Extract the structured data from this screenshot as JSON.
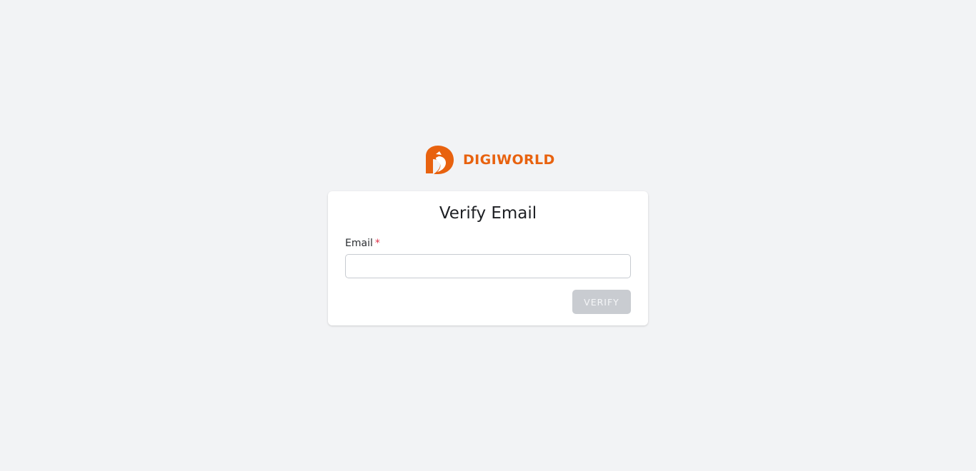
{
  "brand": {
    "name": "DIGIWORLD",
    "color": "#e8620f",
    "logo_icon": "digiworld-logo-icon"
  },
  "form": {
    "title": "Verify Email",
    "email_label": "Email",
    "required_marker": "*",
    "email_value": "",
    "email_placeholder": "",
    "submit_label": "VERIFY",
    "submit_disabled": true
  },
  "colors": {
    "background": "#f2f3f5",
    "card": "#ffffff",
    "required": "#e0334a",
    "button_disabled": "#c9ccd1"
  }
}
